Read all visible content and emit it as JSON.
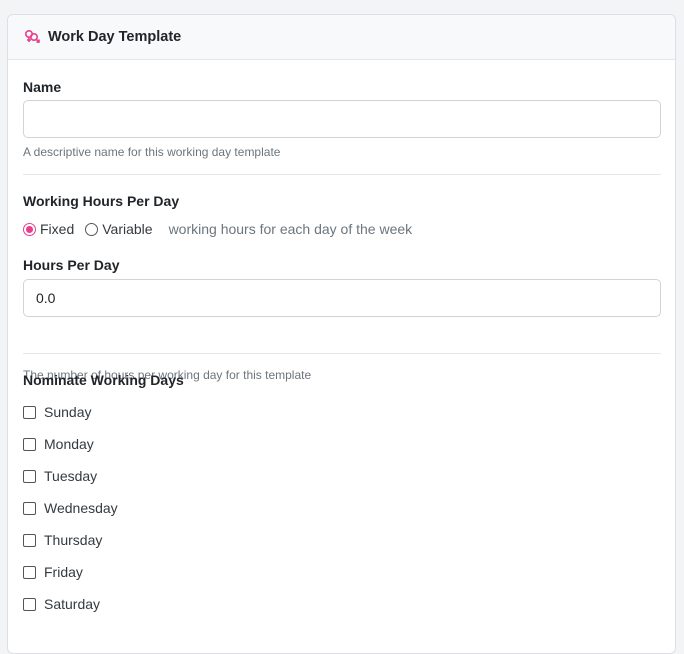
{
  "header": {
    "title": "Work Day Template",
    "icon": "gender-icon"
  },
  "name_field": {
    "label": "Name",
    "value": "",
    "placeholder": "",
    "help": "A descriptive name for this working day template"
  },
  "working_hours": {
    "label": "Working Hours Per Day",
    "options": [
      {
        "label": "Fixed",
        "checked": true
      },
      {
        "label": "Variable",
        "checked": false
      }
    ],
    "hint": "working hours for each day of the week"
  },
  "hours_field": {
    "label": "Hours Per Day",
    "value": "0.0",
    "help": "The number of hours per working day for this template"
  },
  "working_days": {
    "label": "Nominate Working Days",
    "days": [
      {
        "label": "Sunday",
        "checked": false
      },
      {
        "label": "Monday",
        "checked": false
      },
      {
        "label": "Tuesday",
        "checked": false
      },
      {
        "label": "Wednesday",
        "checked": false
      },
      {
        "label": "Thursday",
        "checked": false
      },
      {
        "label": "Friday",
        "checked": false
      },
      {
        "label": "Saturday",
        "checked": false
      }
    ]
  },
  "colors": {
    "accent": "#e83e8c",
    "muted": "#6c757d"
  }
}
